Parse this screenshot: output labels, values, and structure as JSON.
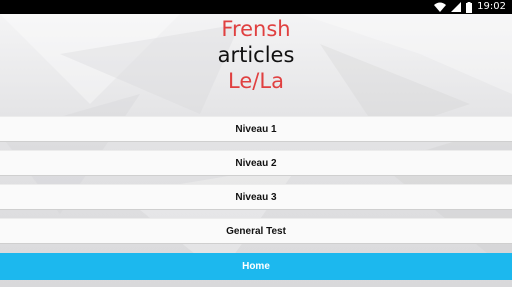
{
  "status_bar": {
    "time": "19:02",
    "icons": [
      "wifi-icon",
      "signal-icon",
      "battery-icon"
    ]
  },
  "title": {
    "line1": "Frensh",
    "line2": "articles",
    "line3": "Le/La"
  },
  "menu": {
    "items": [
      {
        "label": "Niveau 1"
      },
      {
        "label": "Niveau 2"
      },
      {
        "label": "Niveau 3"
      },
      {
        "label": "General Test"
      }
    ],
    "home_label": "Home"
  },
  "colors": {
    "accent_red": "#e04040",
    "home_blue": "#1cb8ee"
  }
}
